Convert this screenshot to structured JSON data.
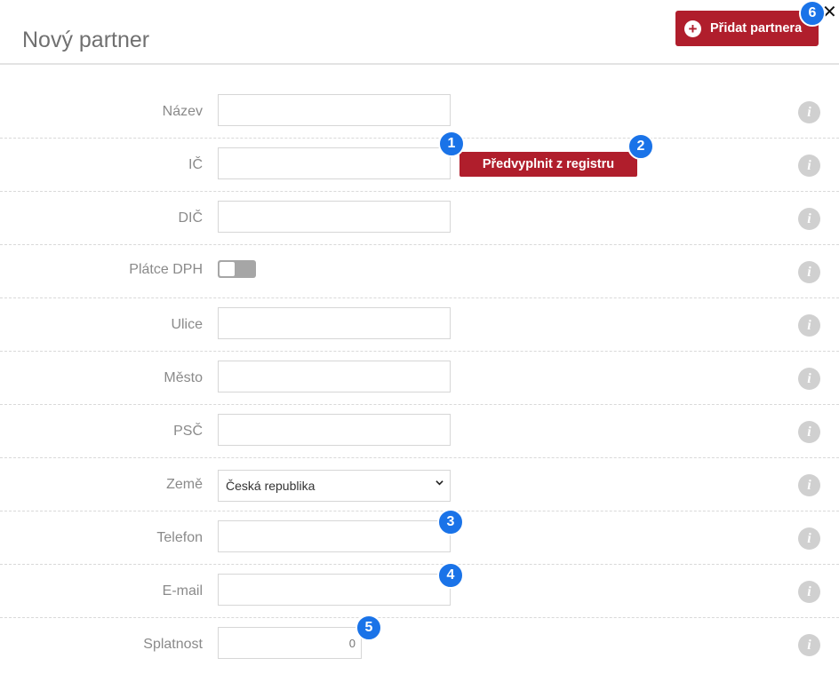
{
  "header": {
    "title": "Nový partner",
    "add_button_label": "Přidat partnera",
    "plus_icon": "+",
    "close_icon": "✕"
  },
  "form": {
    "nazev_label": "Název",
    "ic_label": "IČ",
    "prefill_button_label": "Předvyplnit z registru",
    "dic_label": "DIČ",
    "platce_dph_label": "Plátce DPH",
    "platce_dph_value": false,
    "ulice_label": "Ulice",
    "mesto_label": "Město",
    "psc_label": "PSČ",
    "zeme_label": "Země",
    "zeme_value": "Česká republika",
    "telefon_label": "Telefon",
    "email_label": "E-mail",
    "splatnost_label": "Splatnost",
    "splatnost_value": "0",
    "info_icon_glyph": "i"
  },
  "badges": [
    "1",
    "2",
    "3",
    "4",
    "5",
    "6"
  ],
  "colors": {
    "primary_button": "#b01e2c",
    "badge": "#1a73e8",
    "info_icon": "#d0d0d0",
    "label_text": "#8a8a8a"
  }
}
